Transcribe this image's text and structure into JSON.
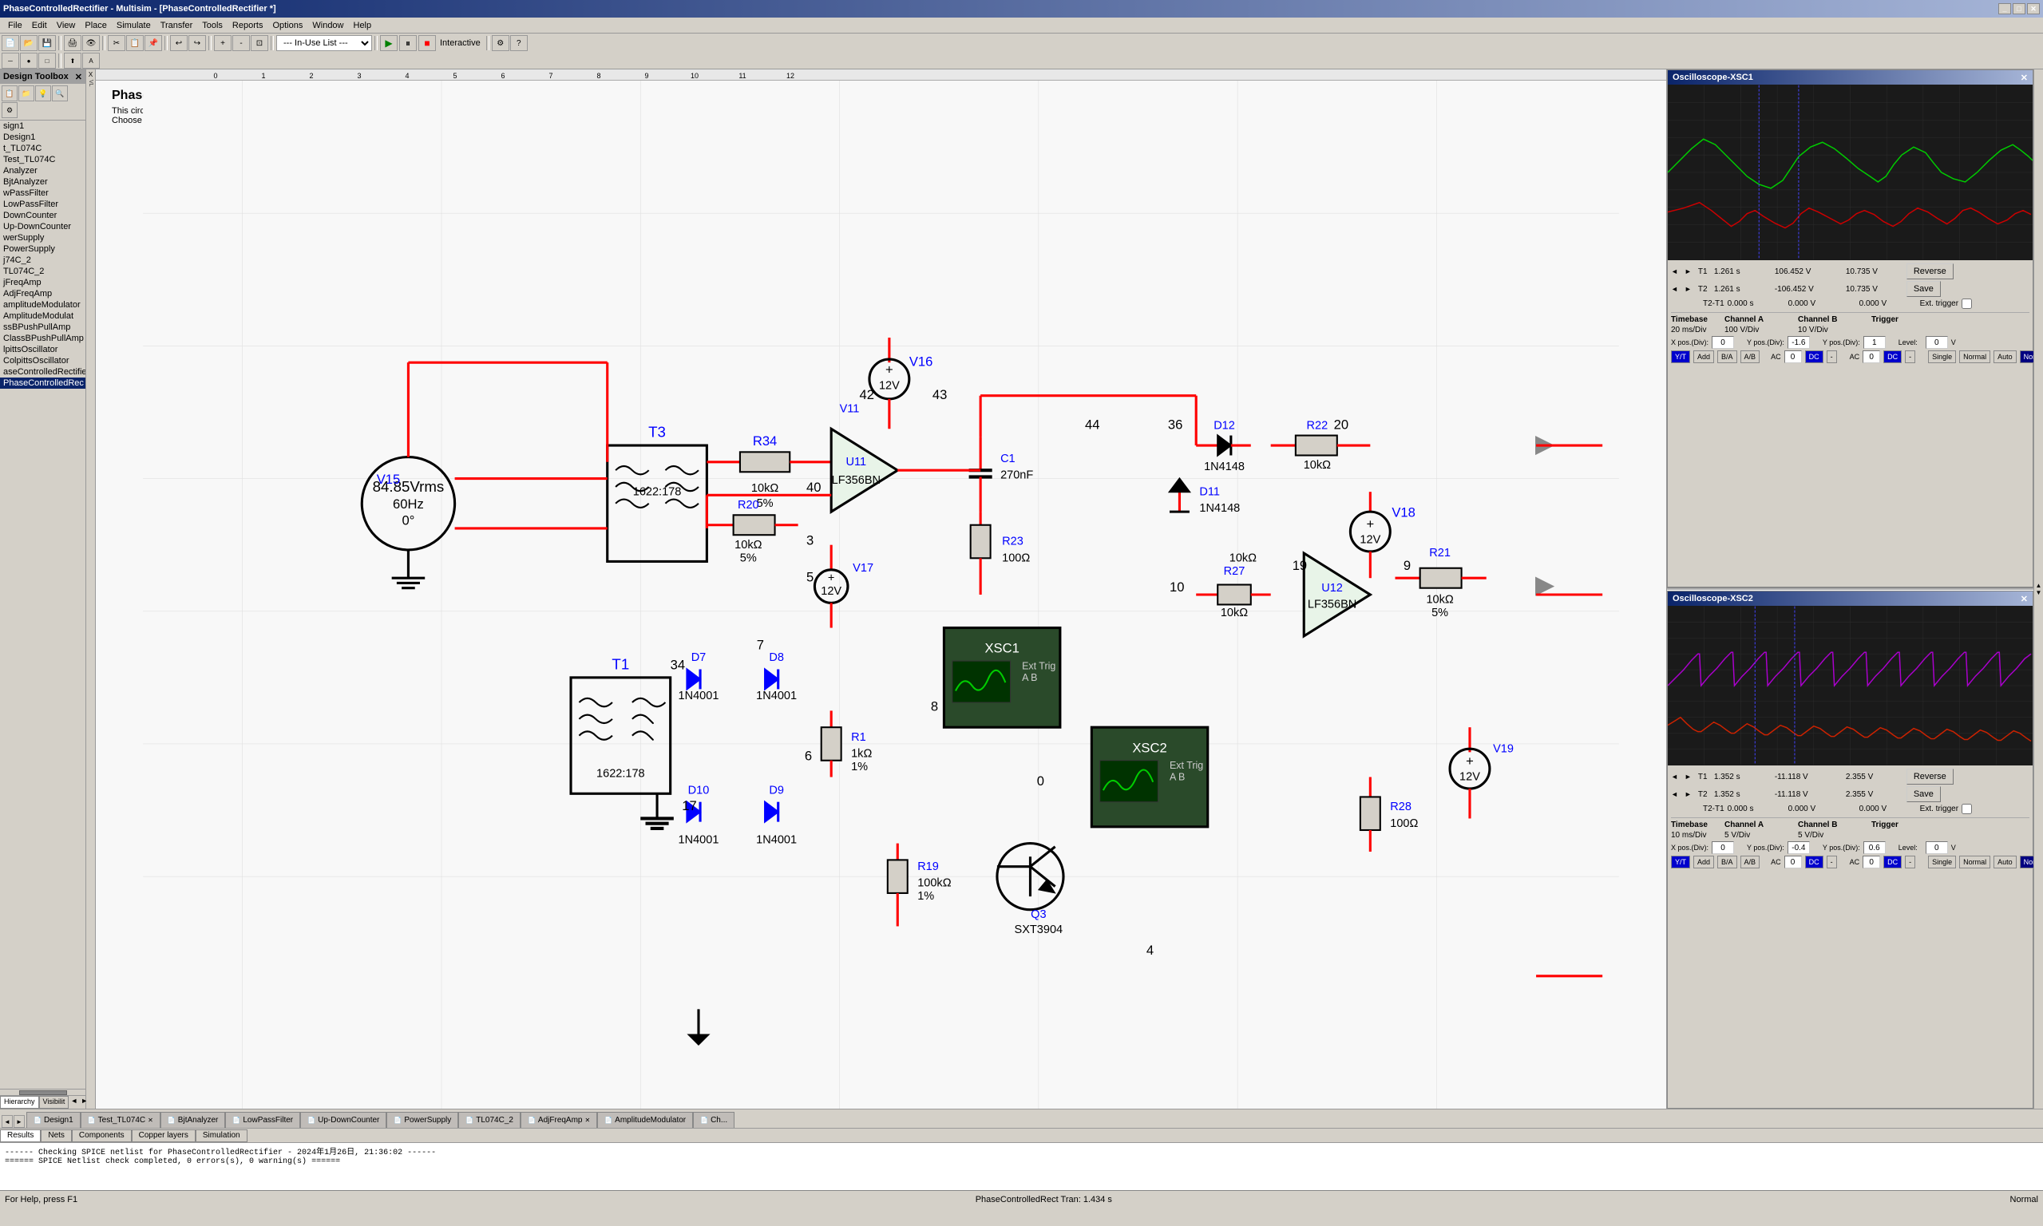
{
  "titlebar": {
    "title": "PhaseControlledRectifier - Multisim - [PhaseControlledRectifier *]",
    "buttons": [
      "_",
      "□",
      "✕"
    ]
  },
  "menu": {
    "items": [
      "File",
      "Edit",
      "View",
      "Place",
      "Simulate",
      "Transfer",
      "Tools",
      "Reports",
      "Options",
      "Window",
      "Help"
    ]
  },
  "toolbar": {
    "in_use_list": "--- In-Use List ---",
    "sim_mode": "Interactive"
  },
  "design_toolbox": {
    "title": "Design Toolbox",
    "designs": [
      "sign1",
      "Design1",
      "t_TL074C",
      "Test_TL074C",
      "Analyzer",
      "BjtAnalyzer",
      "wPassFilter",
      "LowPassFilter",
      "DownCounter",
      "Up-DownCounter",
      "werSupply",
      "PowerSupply",
      "j74C_2",
      "TL074C_2",
      "jFreqAmp",
      "AdjFreqAmp",
      "amplitudeModulator",
      "AmplitudeModulat",
      "ssBPushPullAmp",
      "ClassBPushPullAmp",
      "lpittsOscillator",
      "ColpittsOscillator",
      "aseControlledRectifie",
      "PhaseControlledRec"
    ]
  },
  "schematic": {
    "title": "Phase-controlled rectifier circuit",
    "desc1": "This circuit is designed for closed-loop control systems.",
    "desc2": "Choose Simulate>>Run to view the operation of the circuit using the virtual instruments."
  },
  "osc1": {
    "title": "Oscilloscope-XSC1",
    "measurements": {
      "T1_time": "1.261 s",
      "T1_chA": "106.452 V",
      "T1_chB": "10.735 V",
      "T2_time": "1.261 s",
      "T2_chA": "-106.452 V",
      "T2_chB": "10.735 V",
      "T2T1_time": "0.000 s",
      "T2T1_chA": "0.000 V",
      "T2T1_chB": "0.000 V"
    },
    "timebase": {
      "label": "Timebase",
      "scale": "20 ms/Div",
      "x_pos": "0"
    },
    "channelA": {
      "label": "Channel A",
      "scale": "100 V/Div",
      "y_pos": "-1.6"
    },
    "channelB": {
      "label": "Channel B",
      "scale": "10 V/Div",
      "y_pos": "1"
    },
    "trigger": {
      "label": "Trigger",
      "level": "0",
      "level_unit": "V"
    },
    "buttons": {
      "reverse": "Reverse",
      "save": "Save",
      "ext_trigger": "Ext. trigger",
      "yt": "Y/T",
      "add": "Add",
      "ba": "B/A",
      "ab": "A/B",
      "ac_a": "AC",
      "dc_a": "DC",
      "ac_b": "AC",
      "dc_b": "DC",
      "single": "Single",
      "normal": "Normal",
      "auto": "Auto",
      "none": "None"
    }
  },
  "osc2": {
    "title": "Oscilloscope-XSC2",
    "measurements": {
      "T1_time": "1.352 s",
      "T1_chA": "-11.118 V",
      "T1_chB": "2.355 V",
      "T2_time": "1.352 s",
      "T2_chA": "-11.118 V",
      "T2_chB": "2.355 V",
      "T2T1_time": "0.000 s",
      "T2T1_chA": "0.000 V",
      "T2T1_chB": "0.000 V"
    },
    "timebase": {
      "label": "Timebase",
      "scale": "10 ms/Div",
      "x_pos": "0"
    },
    "channelA": {
      "label": "Channel A",
      "scale": "5 V/Div",
      "y_pos": "-0.4"
    },
    "channelB": {
      "label": "Channel B",
      "scale": "5 V/Div",
      "y_pos": "0.6"
    },
    "trigger": {
      "label": "Trigger",
      "level": "0",
      "level_unit": "V"
    },
    "buttons": {
      "reverse": "Reverse",
      "save": "Save",
      "ext_trigger": "Ext. trigger",
      "yt": "Y/T",
      "add": "Add",
      "ba": "B/A",
      "ab": "A/B",
      "ac_a": "AC",
      "dc_a": "DC",
      "ac_b": "AC",
      "dc_b": "DC",
      "single": "Single",
      "normal": "Normal",
      "auto": "Auto",
      "none": "None"
    }
  },
  "bottom_tabs": [
    {
      "label": "Design1",
      "active": false
    },
    {
      "label": "Test_TL074C",
      "active": false
    },
    {
      "label": "BjtAnalyzer",
      "active": false
    },
    {
      "label": "LowPassFilter",
      "active": false
    },
    {
      "label": "Up-DownCounter",
      "active": false
    },
    {
      "label": "PowerSupply",
      "active": false
    },
    {
      "label": "TL074C_2",
      "active": false
    },
    {
      "label": "AdjFreqAmp",
      "active": false
    },
    {
      "label": "AmplitudeModulator",
      "active": false
    },
    {
      "label": "Ch...",
      "active": false
    }
  ],
  "status_tabs": [
    "Results",
    "Nets",
    "Components",
    "Copper layers",
    "Simulation"
  ],
  "output": {
    "line1": "------ Checking SPICE netlist for PhaseControlledRectifier - 2024年1月26日, 21:36:02 ------",
    "line2": "====== SPICE Netlist check completed, 0 errors(s), 0 warning(s) ======"
  },
  "statusbar": {
    "help": "For Help, press F1",
    "status": "PhaseControlledRect Tran: 1.434 s",
    "normal": "Normal"
  },
  "colors": {
    "accent": "#0a246a",
    "grid_bg": "#1a1a1a",
    "grid_line": "#2a2a2a",
    "waveform_green": "#00cc00",
    "waveform_red": "#cc0000",
    "waveform_purple": "#8800cc",
    "waveform_magenta": "#cc00cc"
  }
}
